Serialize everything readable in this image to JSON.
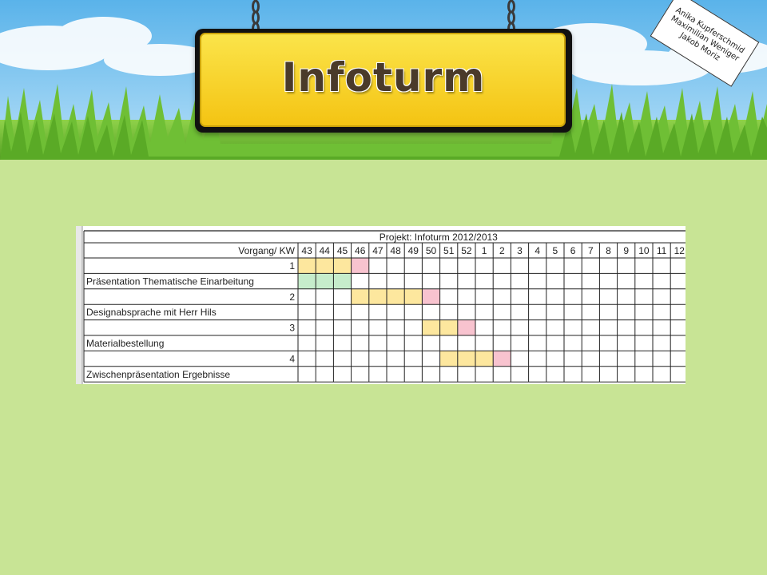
{
  "header": {
    "title": "Infoturm",
    "authors": [
      "Anika Kupferschmid",
      "Maximilian Weniger",
      "Jakob Moriz"
    ]
  },
  "gantt": {
    "project_title": "Projekt: Infoturm 2012/2013",
    "header_label": "Vorgang/ KW",
    "weeks": [
      "43",
      "44",
      "45",
      "46",
      "47",
      "48",
      "49",
      "50",
      "51",
      "52",
      "1",
      "2",
      "3",
      "4",
      "5",
      "6",
      "7",
      "8",
      "9",
      "10",
      "11",
      "12"
    ],
    "rows": [
      {
        "label": "1",
        "align": "right",
        "bars": [
          {
            "from": 0,
            "to": 3,
            "color": "#fde79e"
          },
          {
            "from": 3,
            "to": 4,
            "color": "#f8c3cf"
          }
        ]
      },
      {
        "label": "Präsentation Thematische Einarbeitung",
        "align": "left",
        "bars": [
          {
            "from": 0,
            "to": 3,
            "color": "#c6eccb"
          }
        ]
      },
      {
        "label": "2",
        "align": "right",
        "bars": [
          {
            "from": 3,
            "to": 7,
            "color": "#fde79e"
          },
          {
            "from": 7,
            "to": 8,
            "color": "#f8c3cf"
          }
        ]
      },
      {
        "label": "Designabsprache mit Herr Hils",
        "align": "left",
        "bars": []
      },
      {
        "label": "3",
        "align": "right",
        "bars": [
          {
            "from": 7,
            "to": 9,
            "color": "#fde79e"
          },
          {
            "from": 9,
            "to": 10,
            "color": "#f8c3cf"
          }
        ]
      },
      {
        "label": "Materialbestellung",
        "align": "left",
        "bars": []
      },
      {
        "label": "4",
        "align": "right",
        "bars": [
          {
            "from": 8,
            "to": 11,
            "color": "#fde79e"
          },
          {
            "from": 11,
            "to": 12,
            "color": "#f8c3cf"
          }
        ]
      },
      {
        "label": "Zwischenpräsentation Ergebnisse",
        "align": "left",
        "bars": []
      }
    ]
  }
}
